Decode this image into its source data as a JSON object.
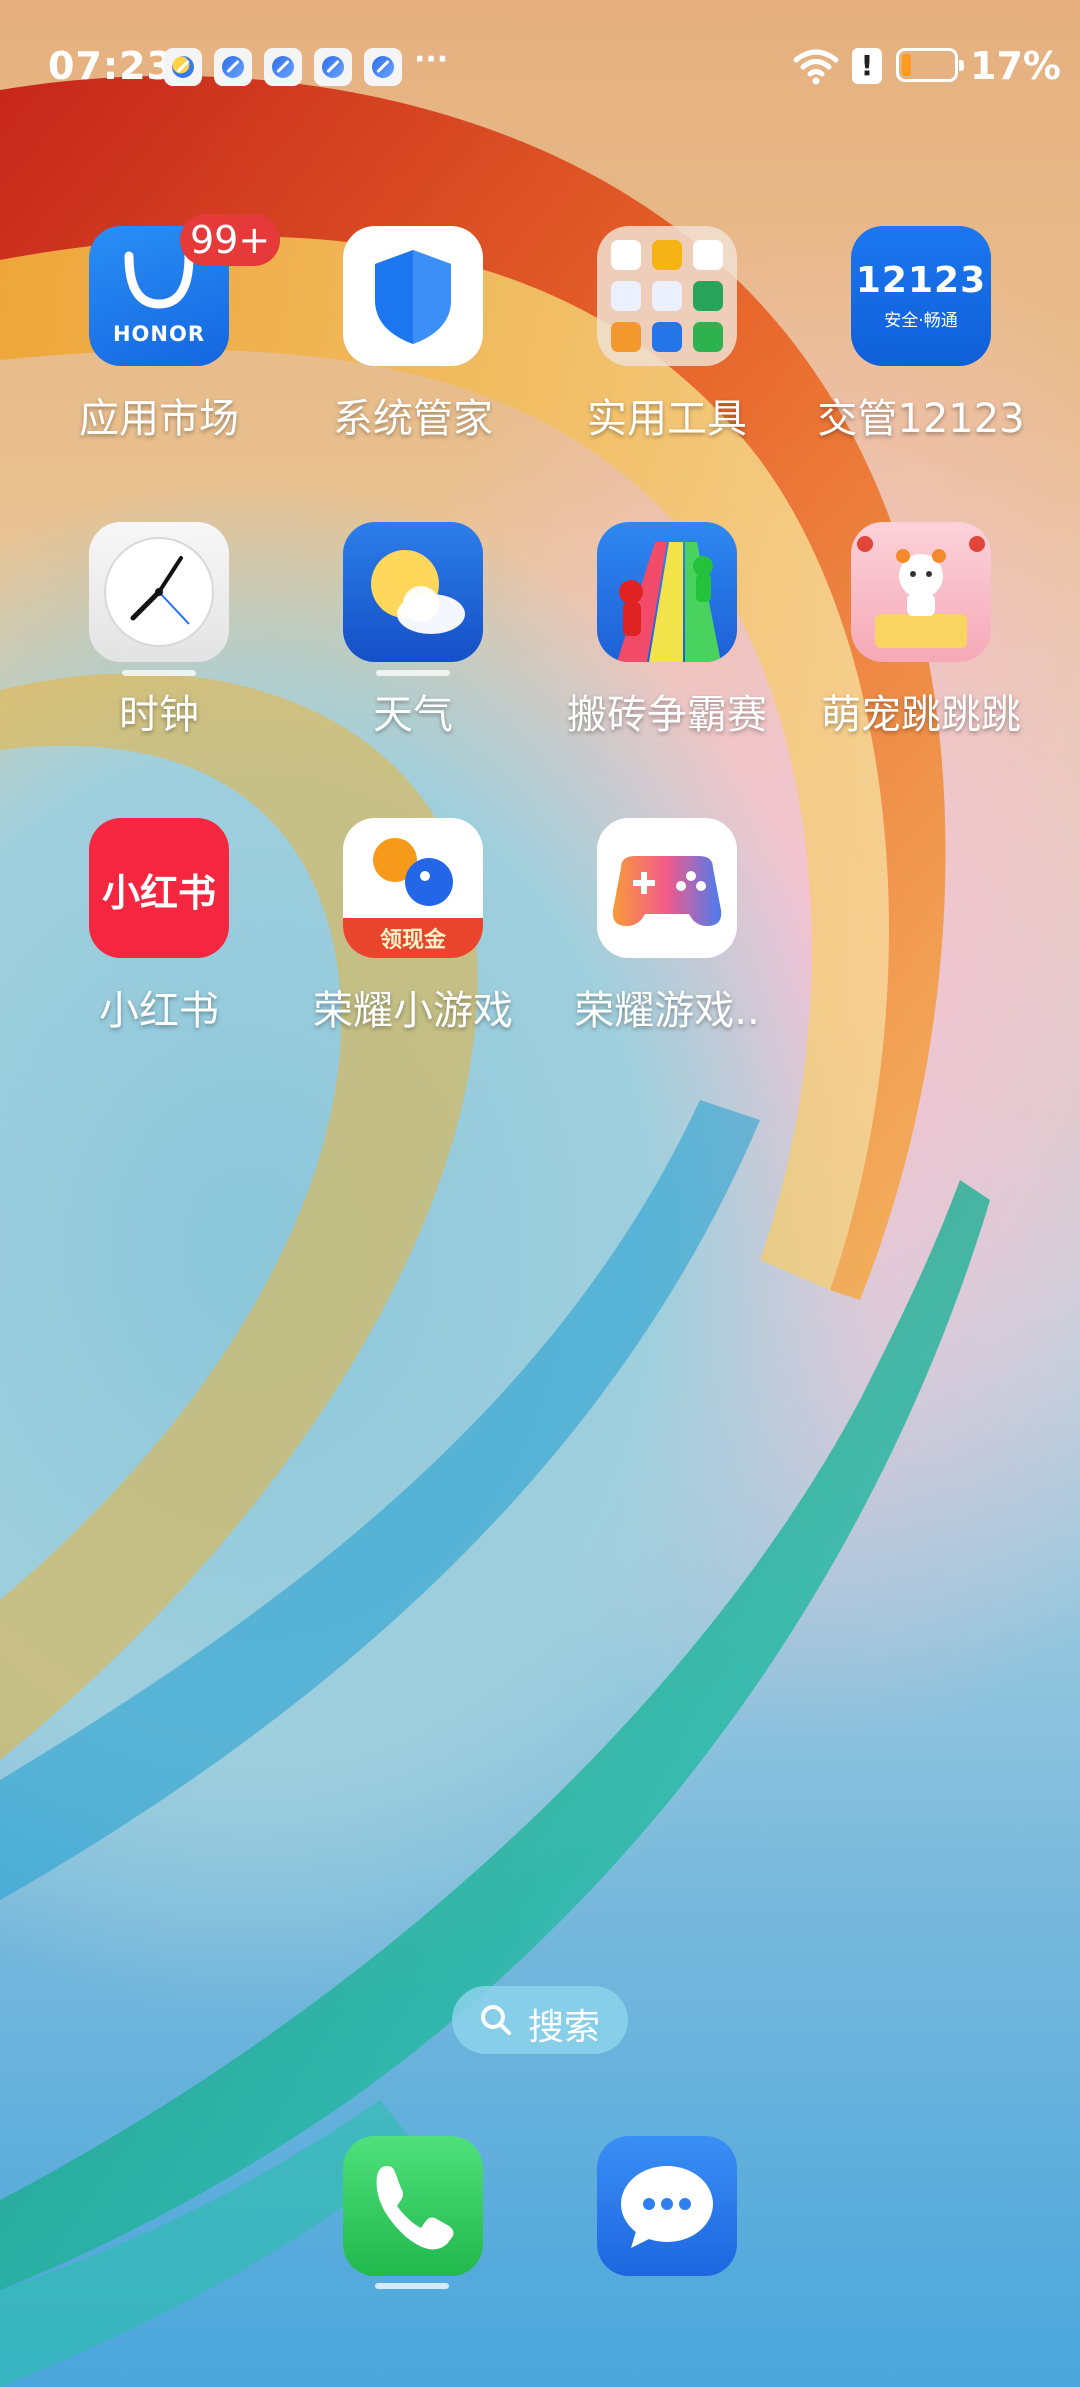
{
  "status_bar": {
    "time": "07:23",
    "more_indicator": "···",
    "battery_percent": "17%",
    "battery_level": 0.17,
    "notification_icons": [
      "weather-icon",
      "browser-icon",
      "browser-icon",
      "browser-icon",
      "browser-icon"
    ]
  },
  "apps": [
    {
      "label": "应用市场",
      "icon": "honor-appstore-icon",
      "badge": "99+",
      "brand_text": "HONOR"
    },
    {
      "label": "系统管家",
      "icon": "shield-icon"
    },
    {
      "label": "实用工具",
      "icon": "folder-tools-icon"
    },
    {
      "label": "交管12123",
      "icon": "traffic-12123-icon",
      "icon_text": "12123",
      "icon_subtext": "安全·畅通"
    },
    {
      "label": "时钟",
      "icon": "clock-icon"
    },
    {
      "label": "天气",
      "icon": "weather-icon"
    },
    {
      "label": "搬砖争霸赛",
      "icon": "brick-race-game-icon"
    },
    {
      "label": "萌宠跳跳跳",
      "icon": "pet-jump-game-icon"
    },
    {
      "label": "小红书",
      "icon": "xiaohongshu-icon",
      "icon_text": "小红书"
    },
    {
      "label": "荣耀小游戏",
      "icon": "honor-minigame-icon",
      "icon_text": "领现金"
    },
    {
      "label": "荣耀游戏..",
      "icon": "gamepad-icon"
    }
  ],
  "search": {
    "label": "搜索"
  },
  "dock": [
    {
      "icon": "phone-icon"
    },
    {
      "icon": "messages-icon"
    }
  ],
  "colors": {
    "badge": "#e5393a",
    "battery_fill": "#ff9a1f",
    "phone_green": "#2fc85a",
    "message_blue": "#2f7ff0"
  }
}
